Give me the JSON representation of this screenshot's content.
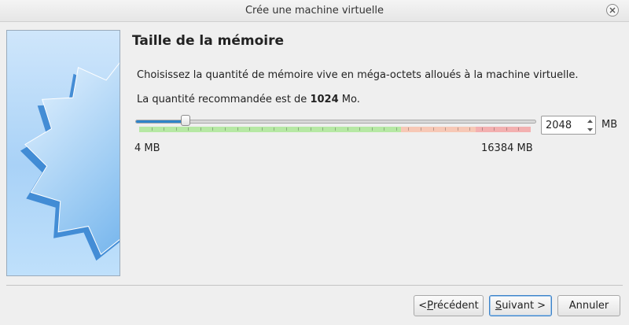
{
  "window": {
    "title": "Crée une machine virtuelle"
  },
  "page": {
    "title": "Taille de la mémoire",
    "description": "Choisissez la quantité de mémoire vive en méga-octets alloués à la machine virtuelle.",
    "recommendation_prefix": "La quantité recommandée est de ",
    "recommendation_value": "1024",
    "recommendation_suffix": " Mo."
  },
  "memory": {
    "value": "2048",
    "unit": "MB",
    "min_label": "4 MB",
    "max_label": "16384 MB",
    "min": 4,
    "max": 16384,
    "current": 2048
  },
  "buttons": {
    "prev_mnemonic": "P",
    "prev_rest": "récédent",
    "prev_prefix": "< ",
    "next_mnemonic": "S",
    "next_rest": "uivant >",
    "cancel": "Annuler"
  },
  "colors": {
    "accent": "#2e84c9",
    "zone_green": "#b6e8a4",
    "zone_orange": "#f7c8b6",
    "zone_red": "#f3b0b0"
  },
  "icons": {
    "close": "close-icon",
    "wizard_art": "starburst-illustration"
  }
}
